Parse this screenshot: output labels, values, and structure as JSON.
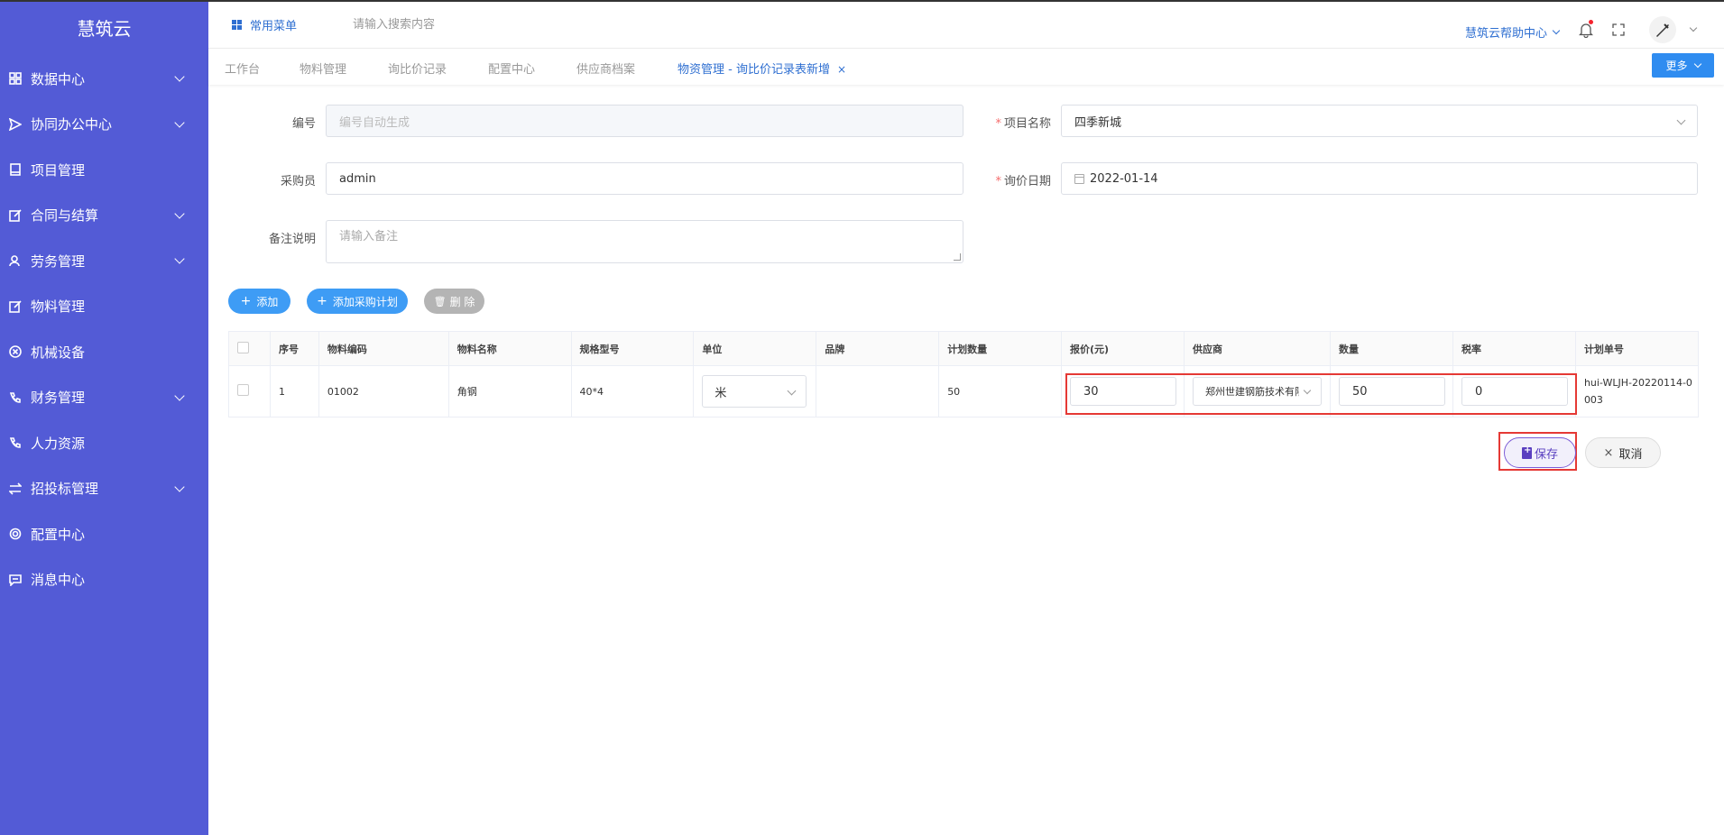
{
  "app": {
    "logo": "慧筑云"
  },
  "sidebar": {
    "items": [
      {
        "label": "数据中心",
        "icon": "grid-icon",
        "expandable": true
      },
      {
        "label": "协同办公中心",
        "icon": "send-icon",
        "expandable": true
      },
      {
        "label": "项目管理",
        "icon": "book-icon",
        "expandable": false
      },
      {
        "label": "合同与结算",
        "icon": "edit-icon",
        "expandable": true
      },
      {
        "label": "劳务管理",
        "icon": "user-icon",
        "expandable": true
      },
      {
        "label": "物料管理",
        "icon": "edit-icon",
        "expandable": false
      },
      {
        "label": "机械设备",
        "icon": "circle-x-icon",
        "expandable": false
      },
      {
        "label": "财务管理",
        "icon": "phone-icon",
        "expandable": true
      },
      {
        "label": "人力资源",
        "icon": "phone-icon",
        "expandable": false
      },
      {
        "label": "招投标管理",
        "icon": "swap-icon",
        "expandable": true
      },
      {
        "label": "配置中心",
        "icon": "gear-icon",
        "expandable": false
      },
      {
        "label": "消息中心",
        "icon": "message-icon",
        "expandable": false
      }
    ]
  },
  "header": {
    "quick_menu": "常用菜单",
    "search_placeholder": "请输入搜索内容",
    "help_center": "慧筑云帮助中心"
  },
  "tabs": {
    "items": [
      "工作台",
      "物料管理",
      "询比价记录",
      "配置中心",
      "供应商档案",
      "物资管理 - 询比价记录表新增"
    ],
    "active_index": 5,
    "more": "更多"
  },
  "form": {
    "code_label": "编号",
    "code_placeholder": "编号自动生成",
    "project_label": "项目名称",
    "project_value": "四季新城",
    "buyer_label": "采购员",
    "buyer_value": "admin",
    "date_label": "询价日期",
    "date_value": "2022-01-14",
    "remark_label": "备注说明",
    "remark_placeholder": "请输入备注"
  },
  "actions": {
    "add": "添加",
    "add_plan": "添加采购计划",
    "delete": "删 除"
  },
  "table": {
    "headers": [
      "序号",
      "物料编码",
      "物料名称",
      "规格型号",
      "单位",
      "品牌",
      "计划数量",
      "报价(元)",
      "供应商",
      "数量",
      "税率",
      "计划单号"
    ],
    "rows": [
      {
        "index": "1",
        "code": "01002",
        "name": "角钢",
        "spec": "40*4",
        "unit": "米",
        "brand": "",
        "plan_qty": "50",
        "price": "30",
        "supplier": "郑州世建钢筋技术有限公司",
        "qty": "50",
        "tax": "0",
        "plan_no": "hui-WLJH-20220114-0003"
      }
    ]
  },
  "footer": {
    "save": "保存",
    "cancel": "取消"
  },
  "colors": {
    "sidebar_bg": "#535bd6",
    "primary": "#2f8cf0",
    "highlight": "#e53935"
  }
}
